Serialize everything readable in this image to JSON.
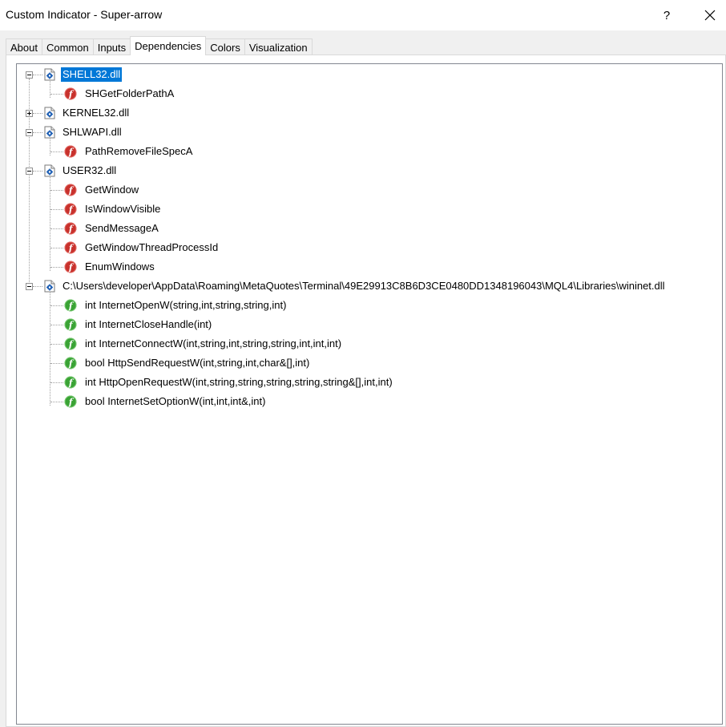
{
  "window": {
    "title": "Custom Indicator - Super-arrow",
    "help_label": "?",
    "close_icon": "close-icon"
  },
  "tabs": [
    {
      "label": "About"
    },
    {
      "label": "Common"
    },
    {
      "label": "Inputs"
    },
    {
      "label": "Dependencies",
      "active": true
    },
    {
      "label": "Colors"
    },
    {
      "label": "Visualization"
    }
  ],
  "tree": {
    "dlls": [
      {
        "name": "SHELL32.dll",
        "expanded": true,
        "selected": true,
        "functions": [
          "SHGetFolderPathA"
        ]
      },
      {
        "name": "KERNEL32.dll",
        "expanded": false,
        "selected": false,
        "functions": []
      },
      {
        "name": "SHLWAPI.dll",
        "expanded": true,
        "selected": false,
        "functions": [
          "PathRemoveFileSpecA"
        ]
      },
      {
        "name": "USER32.dll",
        "expanded": true,
        "selected": false,
        "functions": [
          "GetWindow",
          "IsWindowVisible",
          "SendMessageA",
          "GetWindowThreadProcessId",
          "EnumWindows"
        ]
      },
      {
        "name": "C:\\Users\\developer\\AppData\\Roaming\\MetaQuotes\\Terminal\\49E29913C8B6D3CE0480DD1348196043\\MQL4\\Libraries\\wininet.dll",
        "expanded": true,
        "selected": false,
        "functions": [
          "int InternetOpenW(string,int,string,string,int)",
          "int InternetCloseHandle(int)",
          "int InternetConnectW(int,string,int,string,string,int,int,int)",
          "bool HttpSendRequestW(int,string,int,char&[],int)",
          "int HttpOpenRequestW(int,string,string,string,string,string&[],int,int)",
          "bool InternetSetOptionW(int,int,int&,int)"
        ]
      }
    ]
  },
  "colors": {
    "selection": "#0078d7",
    "system_function_icon": "#c8322d",
    "library_function_icon": "#3aa335",
    "dll_icon": "#1e5fb4"
  }
}
